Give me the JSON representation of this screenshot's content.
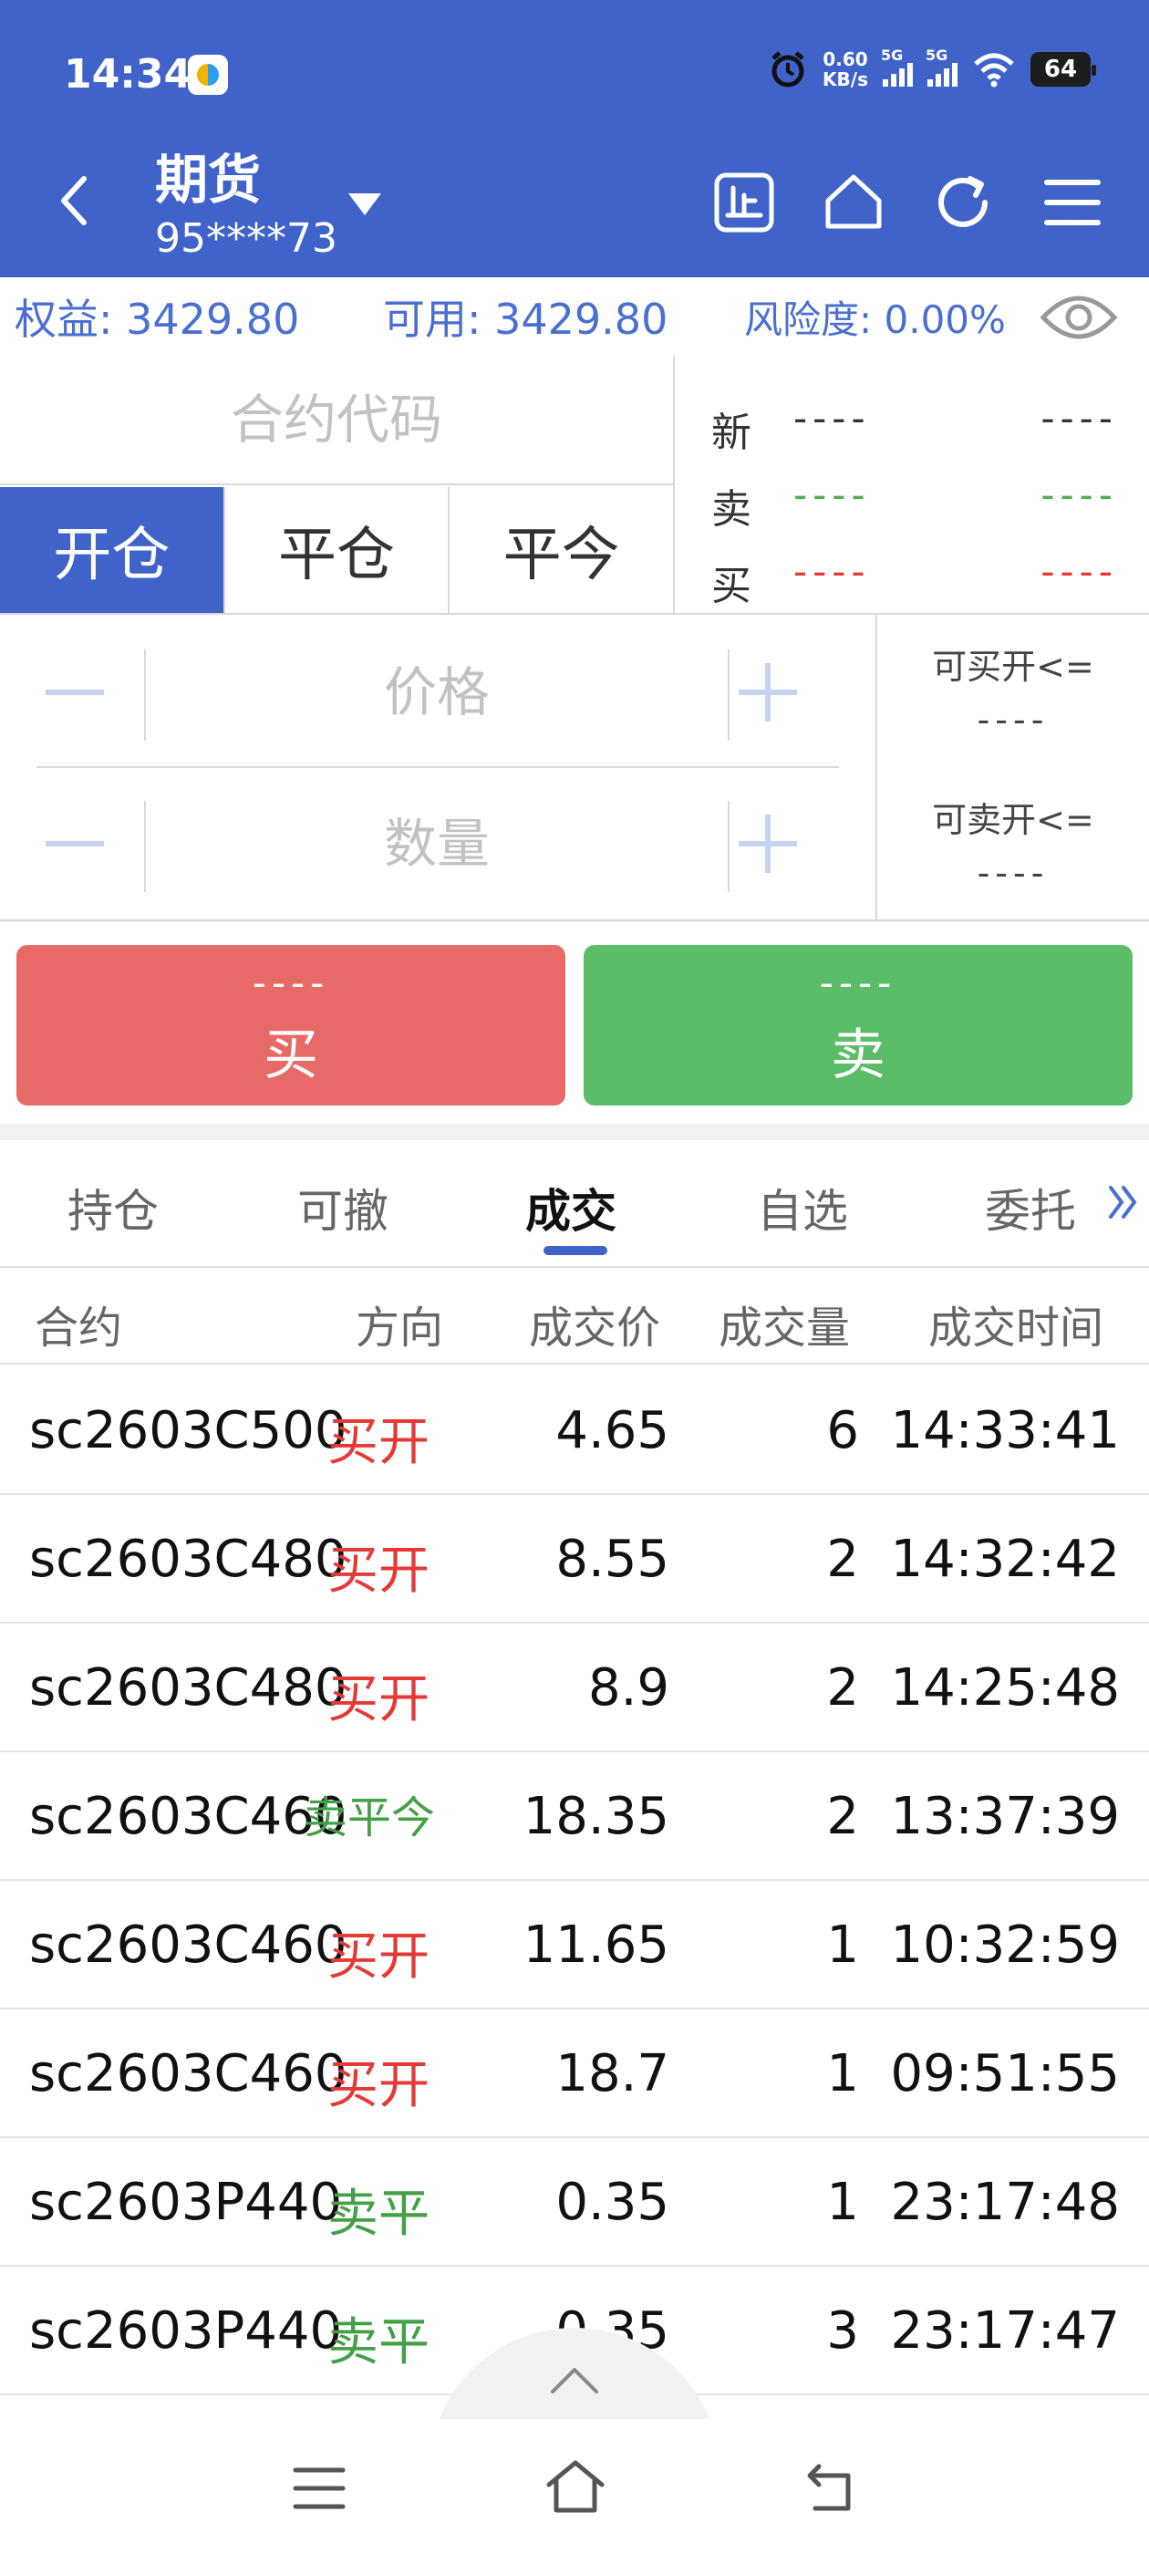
{
  "status_bar": {
    "time": "14:34",
    "speed_value": "0.60",
    "speed_unit": "KB/s",
    "net1": "5G",
    "net2": "5G",
    "battery": "64"
  },
  "header": {
    "title": "期货",
    "account": "95****73"
  },
  "equity": {
    "equity_text": "权益: 3429.80",
    "available_text": "可用: 3429.80",
    "risk_text": "风险度: 0.00%"
  },
  "order_form": {
    "contract_placeholder": "合约代码",
    "mode_tabs": [
      "开仓",
      "平仓",
      "平今"
    ],
    "price_placeholder": "价格",
    "qty_placeholder": "数量",
    "max_buy_label": "可买开<=",
    "max_buy_value": "----",
    "max_sell_label": "可卖开<=",
    "max_sell_value": "----"
  },
  "quote": {
    "new_label": "新",
    "sell_label": "卖",
    "buy_label": "买",
    "new_price": "----",
    "new_vol": "----",
    "sell_price": "----",
    "sell_vol": "----",
    "buy_price": "----",
    "buy_vol": "----"
  },
  "actions": {
    "buy_price": "----",
    "buy_label": "买",
    "sell_price": "----",
    "sell_label": "卖"
  },
  "list_tabs": [
    "持仓",
    "可撤",
    "成交",
    "自选",
    "委托"
  ],
  "table": {
    "headers": [
      "合约",
      "方向",
      "成交价",
      "成交量",
      "成交时间"
    ],
    "rows": [
      {
        "contract": "sc2603C500",
        "dir": "买开",
        "price": "4.65",
        "vol": "6",
        "time": "14:33:41"
      },
      {
        "contract": "sc2603C480",
        "dir": "买开",
        "price": "8.55",
        "vol": "2",
        "time": "14:32:42"
      },
      {
        "contract": "sc2603C480",
        "dir": "买开",
        "price": "8.9",
        "vol": "2",
        "time": "14:25:48"
      },
      {
        "contract": "sc2603C460",
        "dir": "卖平今",
        "price": "18.35",
        "vol": "2",
        "time": "13:37:39"
      },
      {
        "contract": "sc2603C460",
        "dir": "买开",
        "price": "11.65",
        "vol": "1",
        "time": "10:32:59"
      },
      {
        "contract": "sc2603C460",
        "dir": "买开",
        "price": "18.7",
        "vol": "1",
        "time": "09:51:55"
      },
      {
        "contract": "sc2603P440",
        "dir": "卖平",
        "price": "0.35",
        "vol": "1",
        "time": "23:17:48"
      },
      {
        "contract": "sc2603P440",
        "dir": "卖平",
        "price": "0.35",
        "vol": "3",
        "time": "23:17:47"
      }
    ]
  },
  "colors": {
    "brand": "#3f63c8",
    "buy": "#e86a66",
    "sell": "#5cbd68",
    "buy_text": "#e53935",
    "sell_text": "#43a047"
  }
}
